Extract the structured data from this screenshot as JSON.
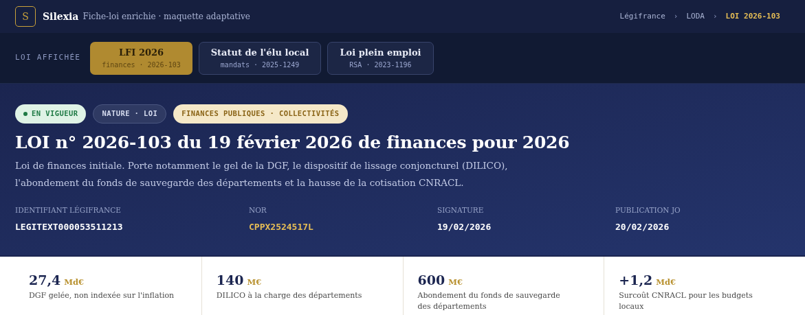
{
  "header": {
    "logo": "S",
    "brand": "Silexia",
    "tagline": "Fiche-loi enrichie · maquette adaptative",
    "breadcrumb": [
      {
        "label": "Légifrance",
        "current": false
      },
      {
        "label": "LODA",
        "current": false
      },
      {
        "label": "LOI 2026-103",
        "current": true
      }
    ],
    "separator": "›"
  },
  "law_picker": {
    "label": "LOI AFFICHÉE",
    "tabs": [
      {
        "title": "LFI 2026",
        "subtitle": "finances · 2026-103",
        "selected": true
      },
      {
        "title": "Statut de l'élu local",
        "subtitle": "mandats · 2025-1249",
        "selected": false
      },
      {
        "title": "Loi plein emploi",
        "subtitle": "RSA · 2023-1196",
        "selected": false
      }
    ]
  },
  "law": {
    "badges": [
      {
        "kind": "status",
        "label": "EN VIGUEUR"
      },
      {
        "kind": "nature",
        "label": "NATURE · LOI"
      },
      {
        "kind": "theme",
        "label": "FINANCES PUBLIQUES · COLLECTIVITÉS"
      }
    ],
    "title": "LOI n° 2026-103 du 19 février 2026 de finances pour 2026",
    "summary": "Loi de finances initiale. Porte notamment le gel de la DGF, le dispositif de lissage conjoncturel (DILICO), l'abondement du fonds de sauvegarde des départements et la hausse de la cotisation CNRACL.",
    "meta": [
      {
        "label": "IDENTIFIANT LÉGIFRANCE",
        "value": "LEGITEXT000053511213",
        "highlight": false
      },
      {
        "label": "NOR",
        "value": "CPPX2524517L",
        "highlight": true
      },
      {
        "label": "SIGNATURE",
        "value": "19/02/2026",
        "highlight": false
      },
      {
        "label": "PUBLICATION JO",
        "value": "20/02/2026",
        "highlight": false
      }
    ]
  },
  "stats": [
    {
      "value": "27,4",
      "unit": "Md€",
      "caption": "DGF gelée, non indexée sur l'inflation"
    },
    {
      "value": "140",
      "unit": "M€",
      "caption": "DILICO à la charge des départements"
    },
    {
      "value": "600",
      "unit": "M€",
      "caption": "Abondement du fonds de sauvegarde des départements"
    },
    {
      "value": "+1,2",
      "unit": "Md€",
      "caption": "Surcoût CNRACL pour les budgets locaux"
    }
  ]
}
